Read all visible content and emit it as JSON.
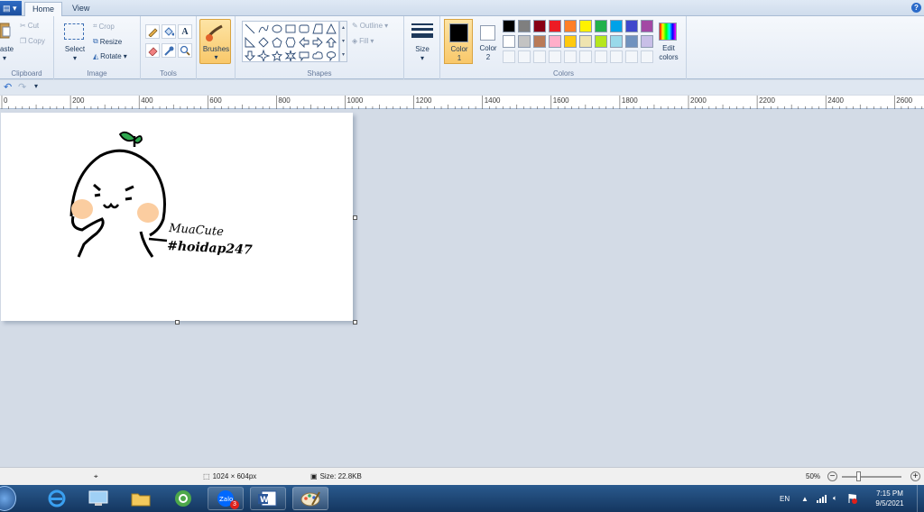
{
  "tabs": {
    "file": "▤",
    "home": "Home",
    "view": "View"
  },
  "clipboard": {
    "paste": "aste",
    "cut": "Cut",
    "copy": "Copy",
    "label": "Clipboard"
  },
  "image": {
    "select": "Select",
    "crop": "Crop",
    "resize": "Resize",
    "rotate": "Rotate",
    "label": "Image"
  },
  "tools": {
    "label": "Tools",
    "text_tool": "A"
  },
  "brushes": {
    "label": "Brushes"
  },
  "shapes": {
    "outline": "Outline",
    "fill": "Fill",
    "label": "Shapes"
  },
  "size": {
    "label": "Size"
  },
  "colors": {
    "color1_label": "Color",
    "color1_num": "1",
    "color2_label": "Color",
    "color2_num": "2",
    "edit_label": "Edit",
    "edit_label2": "colors",
    "label": "Colors",
    "color1_value": "#000000",
    "color2_value": "#ffffff",
    "palette_row1": [
      "#000000",
      "#7f7f7f",
      "#880015",
      "#ed1c24",
      "#ff7f27",
      "#fff200",
      "#22b14c",
      "#00a2e8",
      "#3f48cc",
      "#a349a4"
    ],
    "palette_row2": [
      "#ffffff",
      "#c3c3c3",
      "#b97a57",
      "#ffaec9",
      "#ffc90e",
      "#efe4b0",
      "#b5e61d",
      "#99d9ea",
      "#7092be",
      "#c8bfe7"
    ]
  },
  "ruler": [
    "0",
    "200",
    "400",
    "600",
    "800",
    "1000",
    "1200",
    "1400",
    "1600",
    "1800",
    "2000",
    "2200",
    "2400",
    "2600"
  ],
  "drawing": {
    "name_text": "MuaCute",
    "hashtag_text": "#hoidap247"
  },
  "status": {
    "dimensions": "1024 × 604px",
    "size": "Size: 22.8KB",
    "zoom": "50%"
  },
  "taskbar": {
    "zalo_badge": "3",
    "lang": "EN",
    "time": "7:15 PM",
    "date": "9/5/2021"
  }
}
